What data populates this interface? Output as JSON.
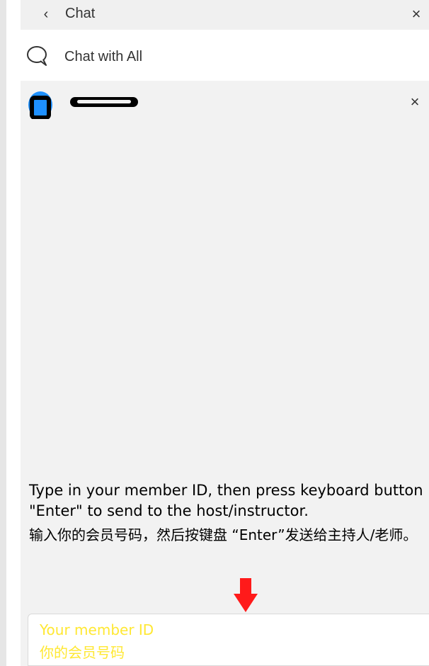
{
  "header": {
    "back_glyph": "‹",
    "title": "Chat",
    "close_glyph": "×"
  },
  "chat_all": {
    "icon": "chat-bubble-icon",
    "label": "Chat with All"
  },
  "contact": {
    "avatar_icon": "user-avatar-icon",
    "name_redacted": true,
    "close_glyph": "×"
  },
  "instructions": {
    "english": "Type in your member ID, then press keyboard button \"Enter\" to send to the host/instructor.",
    "chinese": "输入你的会员号码，然后按键盘 “Enter”发送给主持人/老师。"
  },
  "annotation": {
    "icon": "red-down-arrow-icon",
    "color": "#ff1a1a"
  },
  "message_input": {
    "placeholder": "Your member ID\n你的会员号码",
    "value": "",
    "placeholder_color": "#ffe833"
  },
  "colors": {
    "panel_bg": "#f2f2f2",
    "row_bg": "#ffffff",
    "avatar_accent": "#1e90ff"
  }
}
